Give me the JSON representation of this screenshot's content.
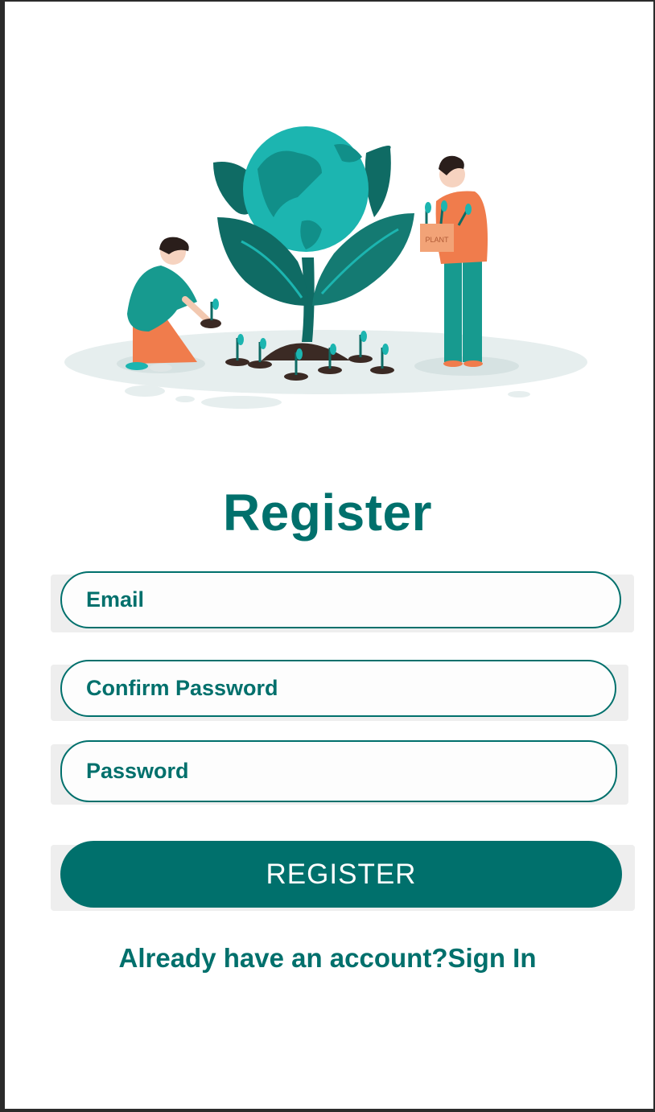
{
  "illustration": {
    "box_label": "PLANT"
  },
  "form": {
    "title": "Register",
    "email_placeholder": "Email",
    "confirm_password_placeholder": "Confirm Password",
    "password_placeholder": "Password",
    "register_label": "REGISTER"
  },
  "footer": {
    "prompt": "Already have an account?",
    "signin_link": "Sign In"
  },
  "colors": {
    "primary": "#00706c",
    "globe": "#1cb5b0",
    "leaf_dark": "#0f6b64",
    "shirt_orange": "#f07c4c",
    "ground": "#e6eeee"
  }
}
